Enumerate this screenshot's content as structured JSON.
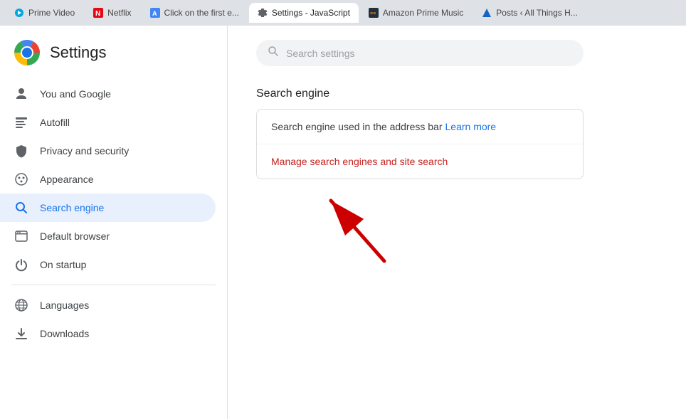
{
  "tabs": [
    {
      "id": "prime-video",
      "label": "Prime Video",
      "icon_color": "#00A8E1",
      "icon_type": "circle-play",
      "active": false
    },
    {
      "id": "netflix",
      "label": "Netflix",
      "icon_color": "#E50914",
      "icon_type": "n-letter",
      "active": false
    },
    {
      "id": "click-on-first",
      "label": "Click on the first e...",
      "icon_color": "#4285F4",
      "icon_type": "a-letter",
      "active": false
    },
    {
      "id": "settings-js",
      "label": "Settings - JavaScript",
      "icon_color": "#5f6368",
      "icon_type": "gear",
      "active": true
    },
    {
      "id": "amazon-music",
      "label": "Amazon Prime Music",
      "icon_color": "#232F3E",
      "icon_type": "music",
      "active": false
    },
    {
      "id": "posts",
      "label": "Posts ‹ All Things H...",
      "icon_color": "#333",
      "icon_type": "triangle",
      "active": false
    }
  ],
  "sidebar": {
    "title": "Settings",
    "nav_items": [
      {
        "id": "you-google",
        "label": "You and Google",
        "icon": "person"
      },
      {
        "id": "autofill",
        "label": "Autofill",
        "icon": "autofill"
      },
      {
        "id": "privacy-security",
        "label": "Privacy and security",
        "icon": "shield"
      },
      {
        "id": "appearance",
        "label": "Appearance",
        "icon": "palette"
      },
      {
        "id": "search-engine",
        "label": "Search engine",
        "icon": "search",
        "active": true
      },
      {
        "id": "default-browser",
        "label": "Default browser",
        "icon": "browser"
      },
      {
        "id": "on-startup",
        "label": "On startup",
        "icon": "power"
      },
      {
        "id": "languages",
        "label": "Languages",
        "icon": "globe"
      },
      {
        "id": "downloads",
        "label": "Downloads",
        "icon": "download"
      }
    ]
  },
  "content": {
    "search_placeholder": "Search settings",
    "section_title": "Search engine",
    "rows": [
      {
        "id": "address-bar-engine",
        "text": "Search engine used in the address bar",
        "link_text": "Learn more",
        "clickable": false
      },
      {
        "id": "manage-search-engines",
        "text": "Manage search engines and site search",
        "link_text": "",
        "clickable": true
      }
    ]
  },
  "colors": {
    "active_nav_bg": "#e8f0fe",
    "active_nav_text": "#1a73e8",
    "link_color": "#1a73e8",
    "manage_text_color": "#c5221f"
  }
}
